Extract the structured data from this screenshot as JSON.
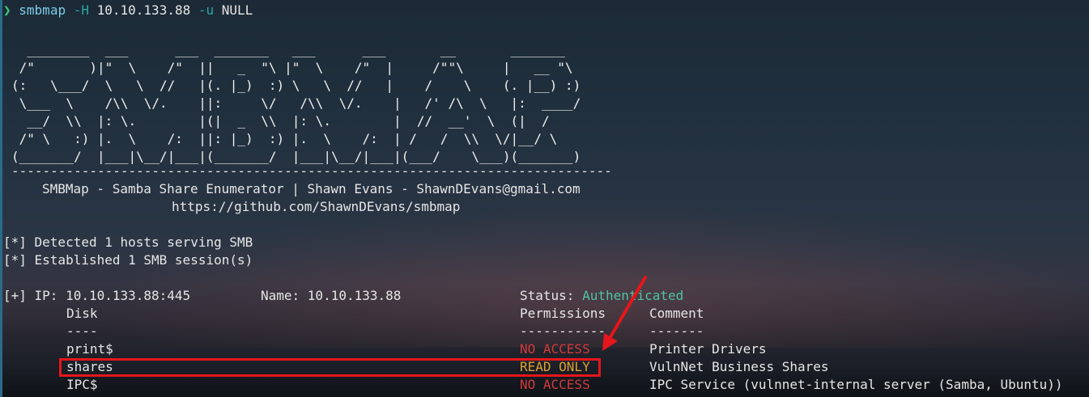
{
  "prompt": {
    "symbol": "❯",
    "command": "smbmap",
    "flag_h": "-H",
    "host": "10.10.133.88",
    "flag_u": "-u",
    "user": "NULL"
  },
  "banner": {
    "ascii": "  ________  ___      ___  _______   ___      ___       __       _______\n /\"       )|\"  \\    /\"  ||   _  \"\\ |\"  \\    /\"  |     /\"\"\\     |   __ \"\\\n(:   \\___/  \\   \\  //   |(. |_)  :) \\   \\  //   |    /    \\    (. |__) :)\n \\___  \\    /\\\\  \\/.    ||:     \\/   /\\\\  \\/.    |   /' /\\  \\   |:  ____/\n  __/  \\\\  |: \\.        |(|  _  \\\\  |: \\.        |  //  __'  \\  (|  /\n /\" \\   :) |.  \\    /:  ||: |_)  :) |.  \\    /:  | /   /  \\\\  \\/|__/ \\\n(_______/  |___|\\__/|___|(_______/  |___|\\__/|___|(___/    \\___)(_______)",
    "rule": "-----------------------------------------------------------------------------",
    "subtitle": "SMBMap - Samba Share Enumerator | Shawn Evans - ShawnDEvans@gmail.com",
    "url": "https://github.com/ShawnDEvans/smbmap"
  },
  "messages": [
    "[*] Detected 1 hosts serving SMB",
    "[*] Established 1 SMB session(s)"
  ],
  "result": {
    "ip_label": "[+] IP: 10.10.133.88:445",
    "name_label": "Name: 10.10.133.88",
    "status_label": "Status:",
    "status_value": "Authenticated",
    "headers": {
      "disk": "Disk",
      "permissions": "Permissions",
      "comment": "Comment"
    },
    "underlines": {
      "disk": "----",
      "permissions": "-----------",
      "comment": "-------"
    },
    "shares": [
      {
        "disk": "print$",
        "permissions": "NO ACCESS",
        "comment": "Printer Drivers"
      },
      {
        "disk": "shares",
        "permissions": "READ ONLY",
        "comment": "VulnNet Business Shares"
      },
      {
        "disk": "IPC$",
        "permissions": "NO ACCESS",
        "comment": "IPC Service (vulnnet-internal server (Samba, Ubuntu))"
      }
    ]
  },
  "colors": {
    "no_access": "#d23a3a",
    "read_only": "#e0a030",
    "authenticated": "#4fc3a1",
    "highlight": "#e5161b"
  }
}
